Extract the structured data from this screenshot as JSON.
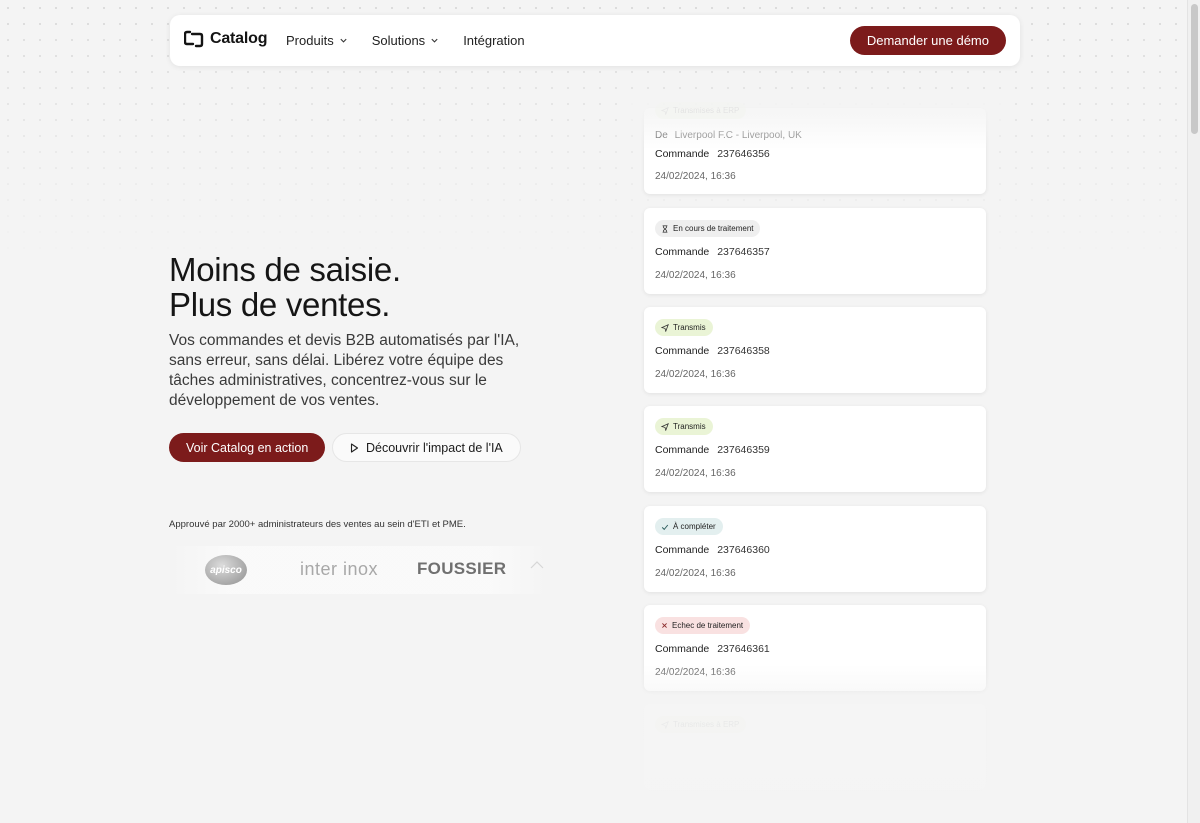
{
  "nav": {
    "logo_text": "Catalog",
    "menu": [
      {
        "label": "Produits",
        "has_dropdown": true
      },
      {
        "label": "Solutions",
        "has_dropdown": true
      },
      {
        "label": "Intégration",
        "has_dropdown": false
      }
    ],
    "demo_label": "Demander une démo"
  },
  "hero": {
    "title_line1": "Moins de saisie.",
    "title_line2": "Plus de ventes.",
    "description": "Vos commandes et devis B2B automatisés par l'IA, sans erreur, sans délai. Libérez votre équipe des tâches administratives, concentrez-vous sur le développement de vos ventes.",
    "cta_primary": "Voir Catalog en action",
    "cta_secondary": "Découvrir l'impact de l'IA"
  },
  "trust": {
    "text": "Approuvé par 2000+ administrateurs des ventes au sein d'ETI et PME.",
    "logos": [
      "apisco",
      "inter inox",
      "FOUSSIER"
    ]
  },
  "orders": {
    "top_badge": "Transmises à ERP",
    "top_from_label": "De",
    "top_from_value": "Liverpool F.C - Liverpool, UK",
    "items": [
      {
        "label": "Commande",
        "number": "237646356",
        "date": "24/02/2024, 16:36"
      },
      {
        "status": "En cours de traitement",
        "label": "Commande",
        "number": "237646357",
        "date": "24/02/2024, 16:36"
      },
      {
        "status": "Transmis",
        "label": "Commande",
        "number": "237646358",
        "date": "24/02/2024, 16:36"
      },
      {
        "status": "Transmis",
        "label": "Commande",
        "number": "237646359",
        "date": "24/02/2024, 16:36"
      },
      {
        "status": "À compléter",
        "label": "Commande",
        "number": "237646360",
        "date": "24/02/2024, 16:36"
      },
      {
        "status": "Echec de traitement",
        "label": "Commande",
        "number": "237646361",
        "date": "24/02/2024, 16:36"
      }
    ],
    "bottom_badge": "Transmises à ERP"
  },
  "colors": {
    "brand": "#7c1b1b",
    "background": "#f4f4f4",
    "sent_badge": "#eaf4d6",
    "complete_badge": "#e3efef",
    "fail_badge": "#f9e1e1"
  }
}
